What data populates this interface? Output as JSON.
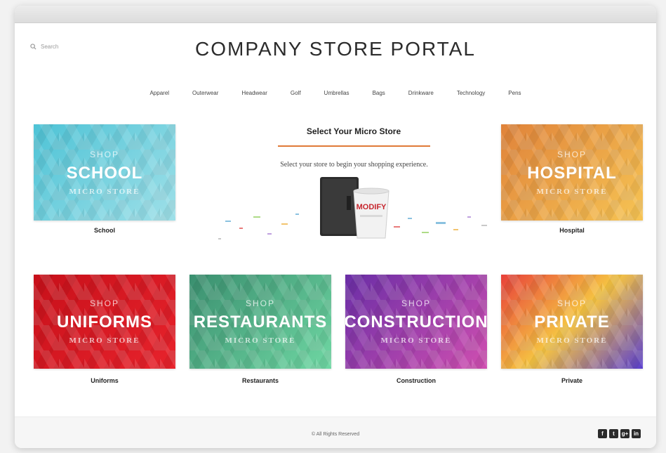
{
  "search": {
    "placeholder": "Search"
  },
  "header": {
    "title": "COMPANY STORE PORTAL"
  },
  "nav": {
    "items": [
      "Apparel",
      "Outerwear",
      "Headwear",
      "Golf",
      "Umbrellas",
      "Bags",
      "Drinkware",
      "Technology",
      "Pens"
    ]
  },
  "center": {
    "title": "Select Your Micro Store",
    "subtitle": "Select your store to begin your shopping experience.",
    "cup_text": "MODIFY"
  },
  "stores": [
    {
      "shop": "SHOP",
      "name": "SCHOOL",
      "micro": "MICRO STORE",
      "caption": "School",
      "colors": [
        "#4ec3d6",
        "#9fe0e8"
      ]
    },
    {
      "shop": "SHOP",
      "name": "HOSPITAL",
      "micro": "MICRO STORE",
      "caption": "Hospital",
      "colors": [
        "#e0833a",
        "#f6c454"
      ]
    },
    {
      "shop": "SHOP",
      "name": "UNIFORMS",
      "micro": "MICRO STORE",
      "caption": "Uniforms",
      "colors": [
        "#c7101a",
        "#e8232c"
      ]
    },
    {
      "shop": "SHOP",
      "name": "RESTAURANTS",
      "micro": "MICRO STORE",
      "caption": "Restaurants",
      "colors": [
        "#3a8f6f",
        "#6fd7a3"
      ]
    },
    {
      "shop": "SHOP",
      "name": "CONSTRUCTION",
      "micro": "MICRO STORE",
      "caption": "Construction",
      "colors": [
        "#6a2ea6",
        "#d04fb0"
      ]
    },
    {
      "shop": "SHOP",
      "name": "PRIVATE",
      "micro": "MICRO STORE",
      "caption": "Private",
      "colors": [
        "#e8403a",
        "#f5c342",
        "#5a3fd0"
      ]
    }
  ],
  "footer": {
    "copyright": "© All Rights Reserved",
    "social": [
      "f",
      "t",
      "g+",
      "in"
    ]
  }
}
